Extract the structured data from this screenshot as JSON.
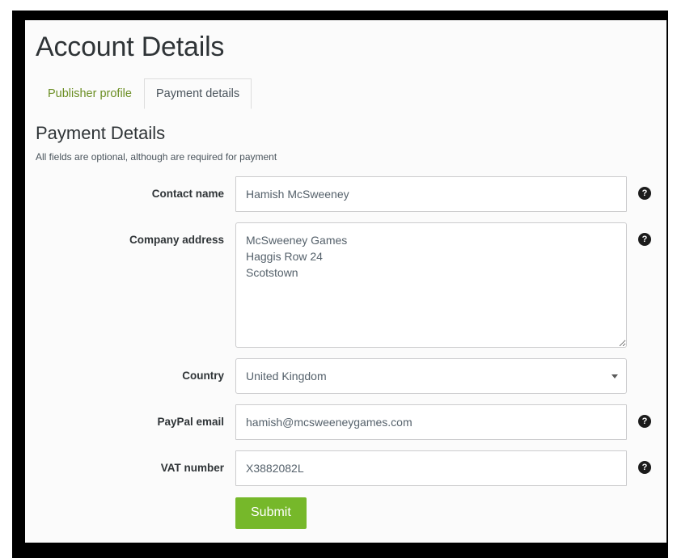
{
  "page": {
    "title": "Account Details"
  },
  "tabs": [
    {
      "label": "Publisher profile",
      "active": false
    },
    {
      "label": "Payment details",
      "active": true
    }
  ],
  "section": {
    "heading": "Payment Details",
    "subtitle": "All fields are optional, although are required for payment"
  },
  "form": {
    "fields": [
      {
        "label": "Contact name",
        "type": "text",
        "value": "Hamish McSweeney",
        "placeholder": "",
        "help_icon": "help-circle-icon",
        "has_help": true
      },
      {
        "label": "Company address",
        "type": "textarea",
        "value": "McSweeney Games\nHaggis Row 24\nScotstown",
        "placeholder": "",
        "help_icon": "help-circle-icon",
        "has_help": true
      },
      {
        "label": "Country",
        "type": "select",
        "value": "United Kingdom",
        "options": [
          "United Kingdom"
        ],
        "has_help": false
      },
      {
        "label": "PayPal email",
        "type": "text",
        "value": "hamish@mcsweeneygames.com",
        "placeholder": "",
        "help_icon": "help-circle-icon",
        "has_help": true
      },
      {
        "label": "VAT number",
        "type": "text",
        "value": "X3882082L",
        "placeholder": "",
        "help_icon": "help-circle-icon",
        "has_help": true
      }
    ],
    "submit_label": "Submit"
  },
  "icons": {
    "help_glyph": "?",
    "select_arrow": "chevron-down-icon"
  },
  "colors": {
    "accent_green": "#76b82a",
    "link_green": "#6b8e23",
    "text_dark": "#2f3437",
    "text_muted": "#55616b",
    "border": "#ccccce",
    "page_bg": "#fbfbfb",
    "frame": "#000000"
  }
}
